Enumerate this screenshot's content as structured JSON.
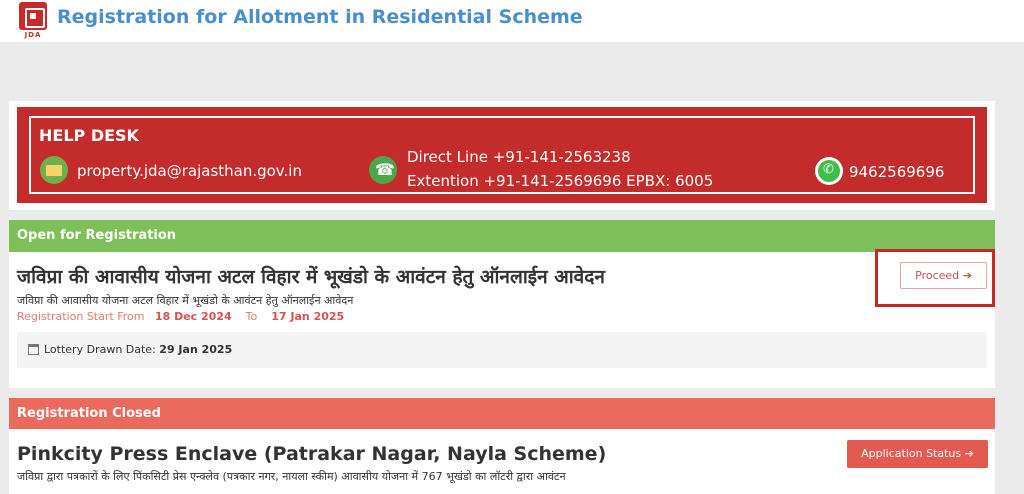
{
  "header": {
    "logo_text": "JDA",
    "title": "Registration for Allotment in Residential Scheme"
  },
  "helpdesk": {
    "title": "HELP DESK",
    "email": "property.jda@rajasthan.gov.in",
    "direct_line": "Direct Line +91-141-2563238",
    "extension": "Extention   +91-141-2569696 EPBX: 6005",
    "whatsapp": "9462569696"
  },
  "open_section": {
    "header": "Open for Registration",
    "title": "जविप्रा की आवासीय योजना अटल विहार में भूखंडो के आवंटन हेतु ऑनलाईन आवेदन",
    "subtitle": "जविप्रा की आवासीय योजना अटल विहार में भूखंडो के आवंटन हेतु ऑनलाईन आवेदन",
    "reg_label": "Registration Start From",
    "start_date": "18 Dec 2024",
    "to_label": "To",
    "end_date": "17 Jan 2025",
    "lottery_label": "Lottery Drawn Date:",
    "lottery_date": "29 Jan 2025",
    "proceed_label": "Proceed ➔"
  },
  "closed_section": {
    "header": "Registration Closed",
    "title": "Pinkcity Press Enclave (Patrakar Nagar, Nayla Scheme)",
    "subtitle": "जविप्रा द्वारा पत्रकारों के लिए पिंकसिटी प्रेस एन्क्लेव (पत्रकार नगर, नायला स्कीम) आवासीय योजना में 767 भूखंडो का लॉटरी द्वारा आवंटन",
    "status_label": "Application Status ➔"
  },
  "colors": {
    "title_blue": "#4a8fc9",
    "helpdesk_red": "#c42b2b",
    "open_green": "#7fbf5a",
    "closed_red": "#ea6a5e",
    "highlight_red": "#c62828"
  }
}
